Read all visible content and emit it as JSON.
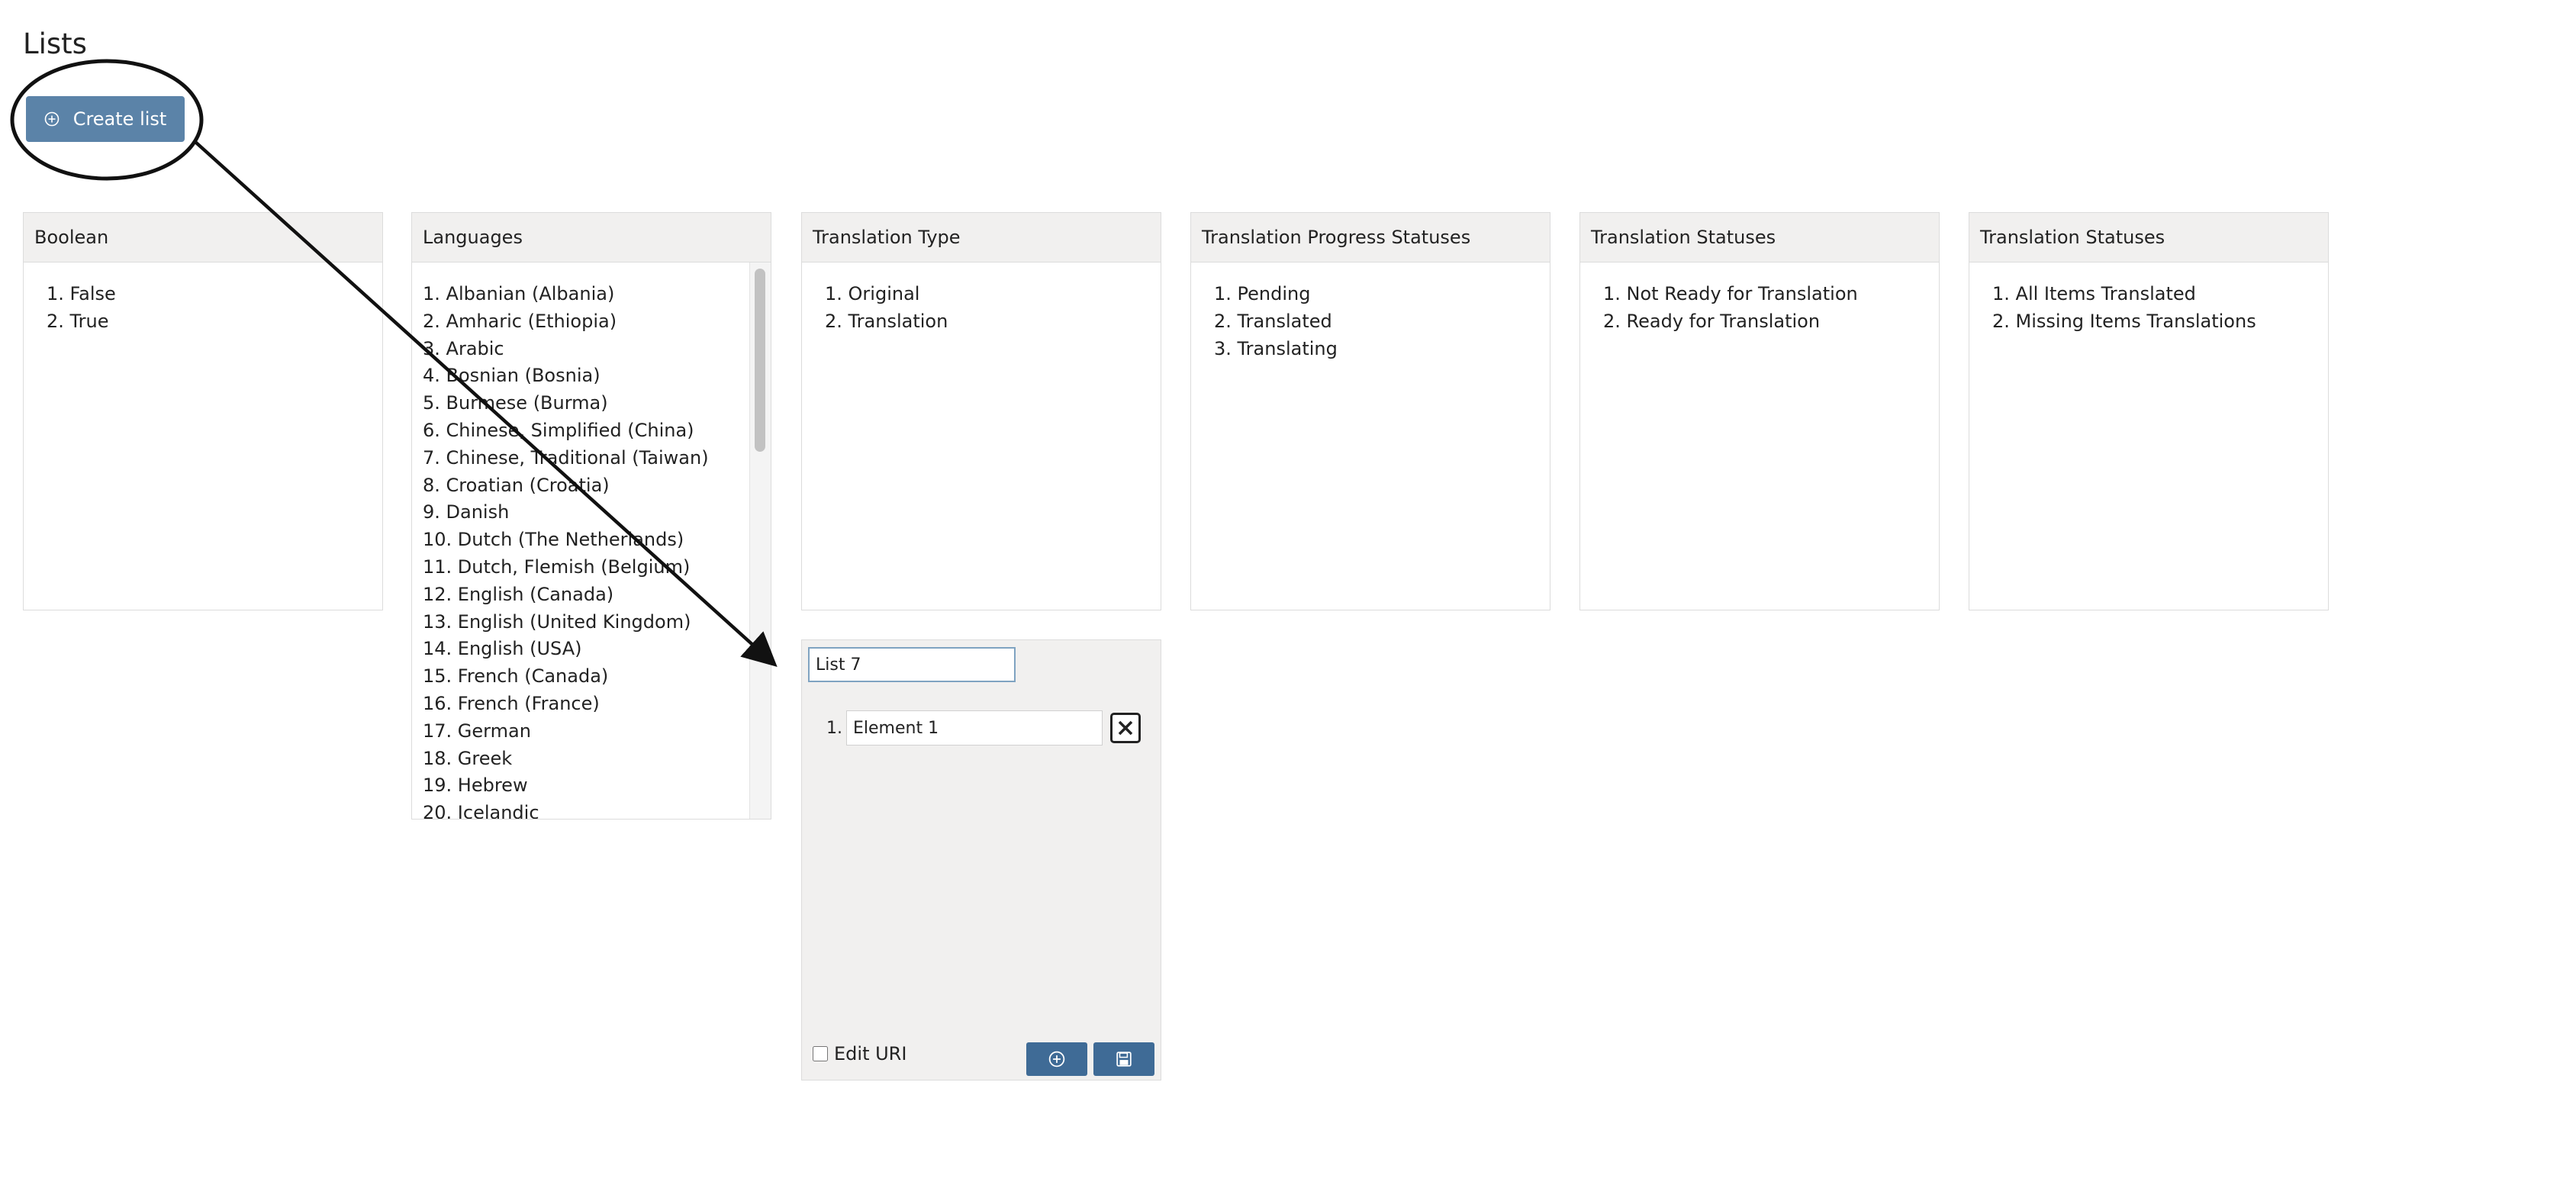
{
  "page": {
    "title": "Lists"
  },
  "toolbar": {
    "create_label": "Create list"
  },
  "panels": [
    {
      "title": "Boolean",
      "items": [
        "1. False",
        "2. True"
      ]
    },
    {
      "title": "Languages",
      "items": [
        "1. Albanian (Albania)",
        "2. Amharic (Ethiopia)",
        "3. Arabic",
        "4. Bosnian (Bosnia)",
        "5. Burmese (Burma)",
        "6. Chinese, Simplified (China)",
        "7. Chinese, Traditional (Taiwan)",
        "8. Croatian (Croatia)",
        "9. Danish",
        "10. Dutch (The Netherlands)",
        "11. Dutch, Flemish (Belgium)",
        "12. English (Canada)",
        "13. English (United Kingdom)",
        "14. English (USA)",
        "15. French (Canada)",
        "16. French (France)",
        "17. German",
        "18. Greek",
        "19. Hebrew",
        "20. Icelandic"
      ]
    },
    {
      "title": "Translation Type",
      "items": [
        "1. Original",
        "2. Translation"
      ]
    },
    {
      "title": "Translation Progress Statuses",
      "items": [
        "1. Pending",
        "2. Translated",
        "3. Translating"
      ]
    },
    {
      "title": "Translation Statuses",
      "items": [
        "1. Not Ready for Translation",
        "2. Ready for Translation"
      ]
    },
    {
      "title": "Translation Statuses",
      "items": [
        "1. All Items Translated",
        "2. Missing Items Translations"
      ]
    }
  ],
  "editor": {
    "list_name": "List 7",
    "element_number": "1.",
    "element_value": "Element 1",
    "edit_uri_label": "Edit URI",
    "edit_uri_checked": false
  },
  "icons": {
    "create": "plus-circle-icon",
    "remove": "close-x-icon",
    "add": "plus-circle-icon",
    "save": "floppy-disk-icon"
  },
  "colors": {
    "create_button": "#5b83a8",
    "action_buttons": "#3f6b96",
    "header_bg": "#f1f0ef",
    "input_focus": "#7fa3c1"
  }
}
